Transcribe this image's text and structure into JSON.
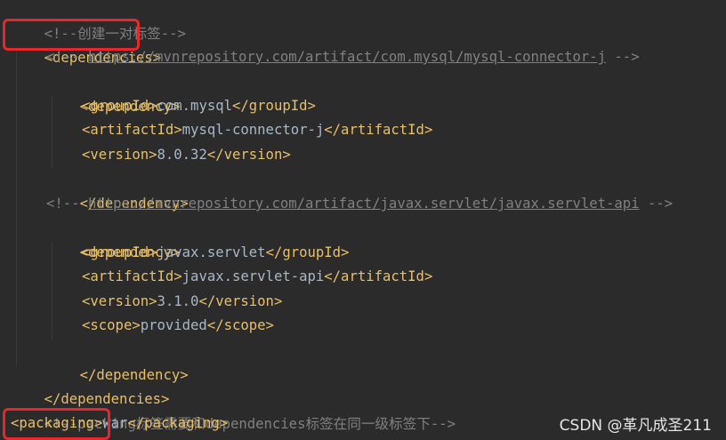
{
  "code": {
    "l1_comment": "<!--创建一对标签-->",
    "l2_tag": "<dependencies>",
    "l3_comment_prefix": "<!-- ",
    "l3_url": "https://mvnrepository.com/artifact/com.mysql/mysql-connector-j",
    "l3_comment_suffix": " -->",
    "l4_tag": "<dependency>",
    "l5_open": "<groupId>",
    "l5_value": "com.mysql",
    "l5_close": "</groupId>",
    "l6_open": "<artifactId>",
    "l6_value": "mysql-connector-j",
    "l6_close": "</artifactId>",
    "l7_open": "<version>",
    "l7_value": "8.0.32",
    "l7_close": "</version>",
    "l8_tag": "</dependency>",
    "l9_comment_prefix": "<!-- ",
    "l9_url": "https://mvnrepository.com/artifact/javax.servlet/javax.servlet-api",
    "l9_comment_suffix": " -->",
    "l10_tag": "<dependency>",
    "l11_open": "<groupId>",
    "l11_value": "javax.servlet",
    "l11_close": "</groupId>",
    "l12_open": "<artifactId>",
    "l12_value": "javax.servlet-api",
    "l12_close": "</artifactId>",
    "l13_open": "<version>",
    "l13_value": "3.1.0",
    "l13_close": "</version>",
    "l14_open": "<scope>",
    "l14_value": "provided",
    "l14_close": "</scope>",
    "l15_tag": "</dependency>",
    "l16_tag": "</dependencies>",
    "l17_comment": "<!--packing标签需要和dependencies标签在同一级标签下-->",
    "l18_open": "<packaging>",
    "l18_value": "war",
    "l18_close": "</packaging>"
  },
  "watermark": "CSDN @革凡成圣211",
  "colors": {
    "background": "#2b2b2b",
    "tag": "#e8bf6a",
    "text": "#a9b7c6",
    "comment": "#808080",
    "highlight_box": "#e8262b"
  }
}
